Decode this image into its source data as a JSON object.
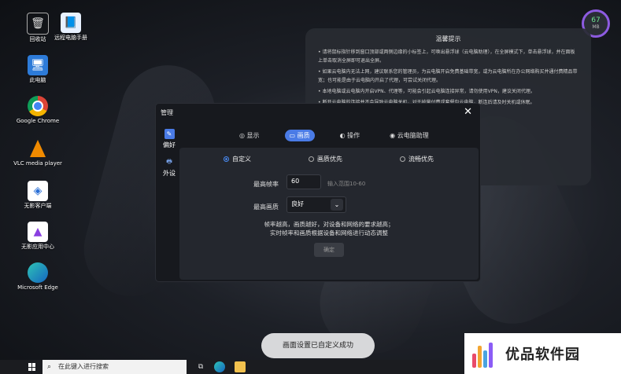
{
  "desktop_icons": [
    {
      "label": "回收站",
      "icon": "recycle-bin-icon"
    },
    {
      "label": "远程电脑手册",
      "icon": "document-icon"
    },
    {
      "label": "此电脑",
      "icon": "computer-icon"
    },
    {
      "label": "Google Chrome",
      "icon": "chrome-icon"
    },
    {
      "label": "VLC media player",
      "icon": "vlc-icon"
    },
    {
      "label": "无影客户端",
      "icon": "app-icon"
    },
    {
      "label": "无影应用中心",
      "icon": "app-center-icon"
    },
    {
      "label": "Microsoft Edge",
      "icon": "edge-icon"
    }
  ],
  "gauge": {
    "value": "67",
    "unit": "MB"
  },
  "tips": {
    "title": "温馨提示",
    "items": [
      "• 请将鼠标指针移到窗口顶部或两侧边缘的小标签上，可唤出悬浮球（云电脑助理），在全屏模式下，单击悬浮球，并在面板上单击取消全屏即可退出全屏。",
      "• 如果云电脑内无法上网，建议联系您的管理员，为云电脑开启免费基础带宽，或为云电脑所在办公网络购买并通付费精品带宽；也可能是由于云电脑内开启了代理，可尝试关闭代理。",
      "• 本地电脑或云电脑内开启VPN、代理等，可能会引起云电脑连接异常，请勿使用VPN，建议关闭代理。",
      "• 断开云电脑的连接并不会导致云电脑关机，对于按量付费或套餐包云电脑，断连后请及时关机或休眠。",
      "请在使用完后及时关闭云电脑，以免产生不必要的费用。"
    ]
  },
  "dialog": {
    "title": "管理",
    "close": "✕",
    "side": [
      {
        "label": "偏好",
        "icon": "edit-icon"
      },
      {
        "label": "外设",
        "icon": "peripheral-icon"
      }
    ],
    "tabs": [
      {
        "label": "◎ 显示"
      },
      {
        "label": "▭ 画质"
      },
      {
        "label": "◐ 操作"
      },
      {
        "label": "◉ 云电脑助理"
      }
    ],
    "radios": [
      "自定义",
      "画质优先",
      "流畅优先"
    ],
    "fps_label": "最高帧率",
    "fps_value": "60",
    "fps_hint": "输入范围10-60",
    "quality_label": "最高画质",
    "quality_value": "良好",
    "note_line1": "帧率越高，画质越好，对设备和网络的要求越高；",
    "note_line2": "实时帧率和画质根据设备和网络进行动态调整",
    "confirm": "确定"
  },
  "toast": "画面设置已自定义成功",
  "taskbar": {
    "search_placeholder": "在此键入进行搜索"
  },
  "brand": {
    "text": "优品软件园"
  }
}
